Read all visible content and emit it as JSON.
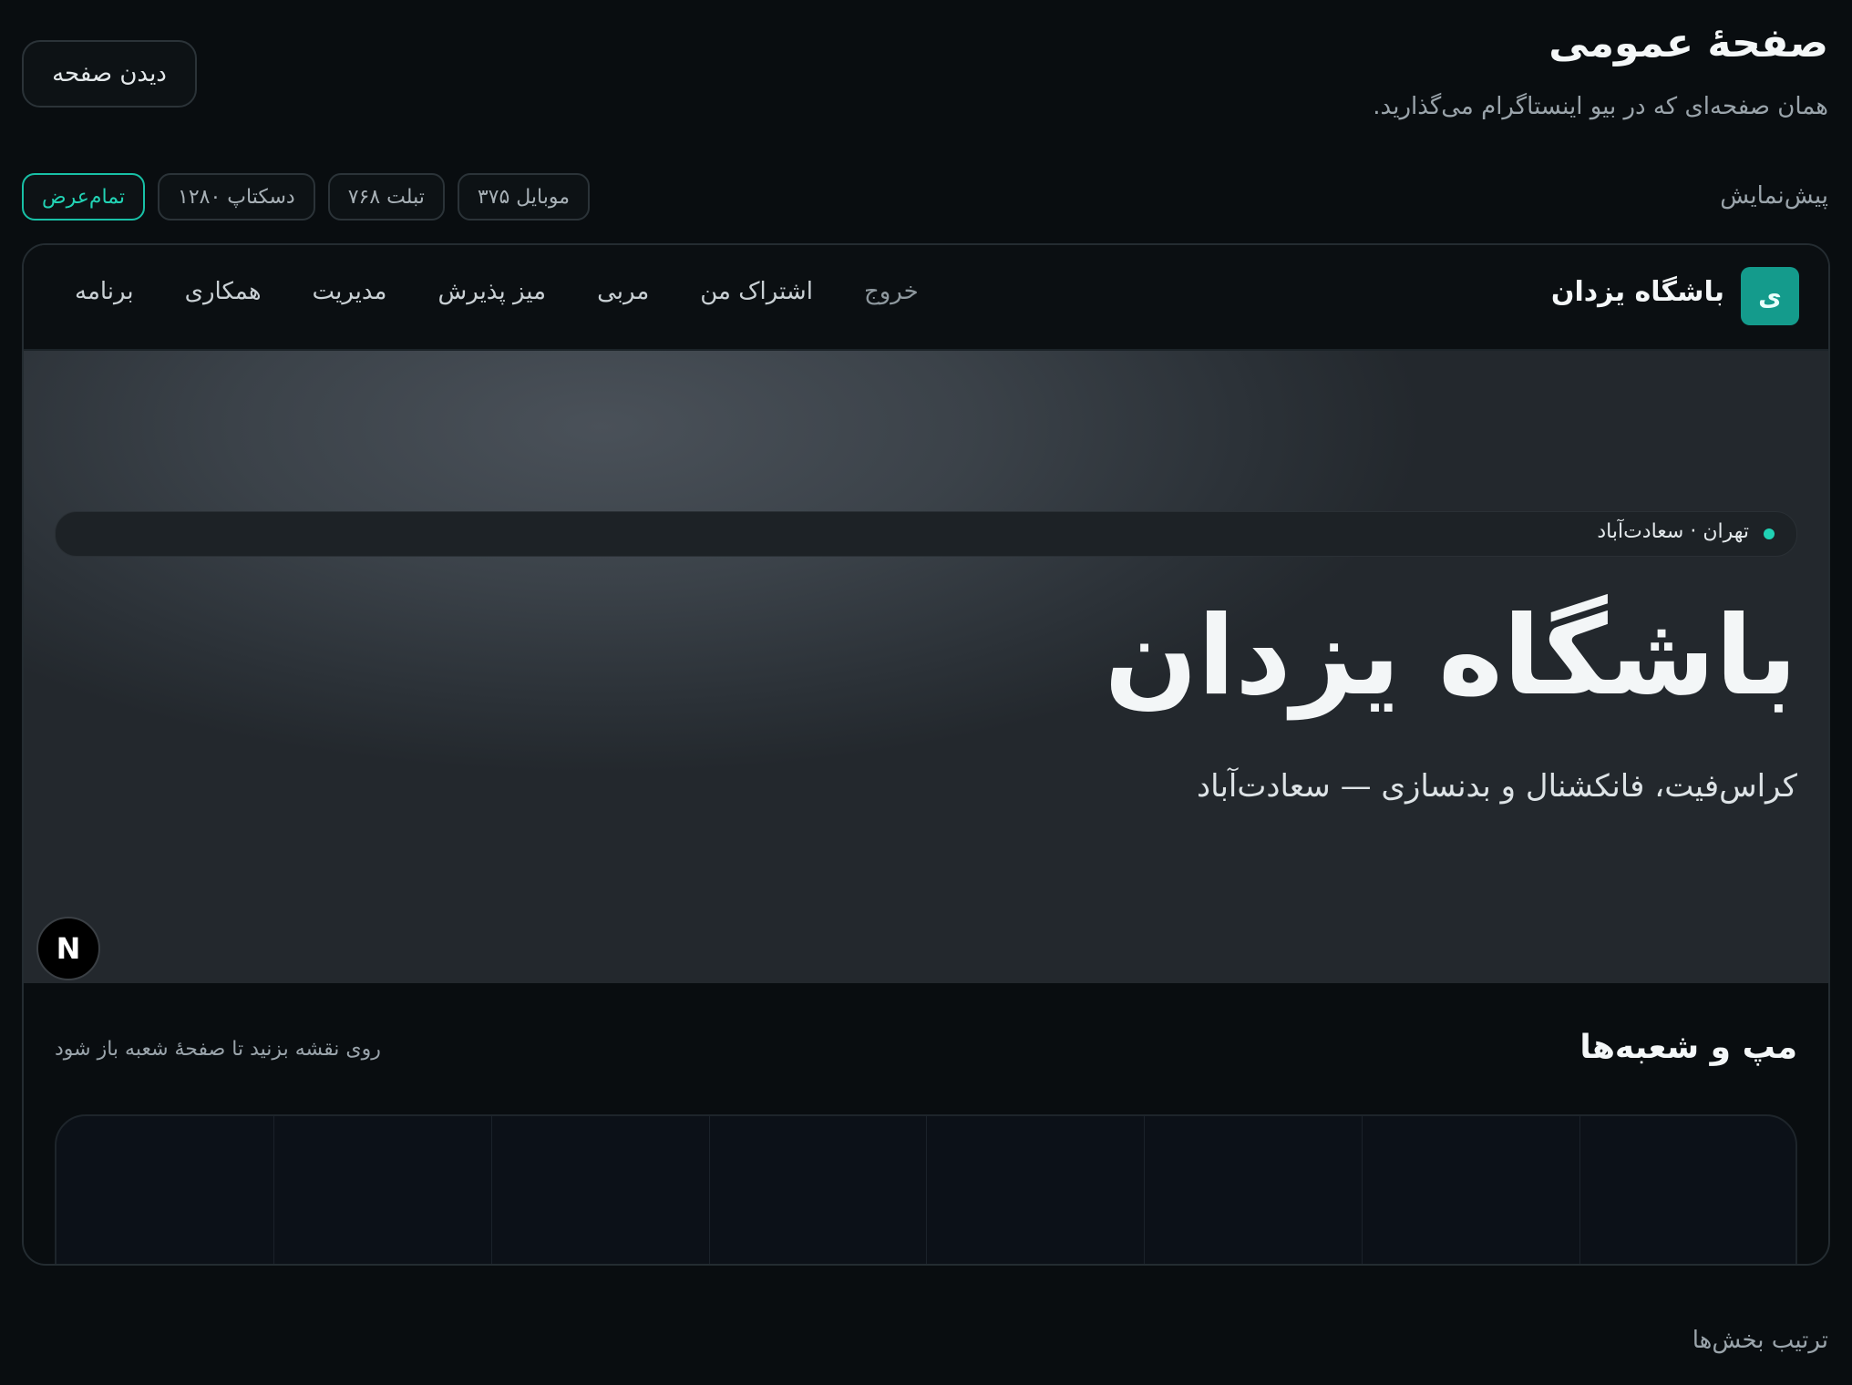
{
  "header": {
    "title": "صفحهٔ عمومی",
    "subtitle": "همان صفحه‌ای که در بیو اینستاگرام می‌گذارید.",
    "view_button": "دیدن صفحه"
  },
  "preview": {
    "label": "پیش‌نمایش",
    "devices": [
      "موبایل ۳۷۵",
      "تبلت ۷۶۸",
      "دسکتاپ ۱۲۸۰",
      "تمام‌عرض"
    ],
    "active_device": "تمام‌عرض"
  },
  "site": {
    "logo_letter": "ی",
    "brand": "باشگاه یزدان",
    "nav": [
      "برنامه",
      "همکاری",
      "مدیریت",
      "میز پذیرش",
      "مربی",
      "اشتراک من",
      "خروج"
    ],
    "hero": {
      "location": "تهران · سعادت‌آباد",
      "title": "باشگاه یزدان",
      "subtitle": "کراس‌فیت، فانکشنال و بدنسازی — سعادت‌آباد"
    },
    "map": {
      "title": "مپ و شعبه‌ها",
      "hint": "روی نقشه بزنید تا صفحهٔ شعبه باز شود"
    },
    "badge_letter": "N"
  },
  "sections": {
    "order_label": "ترتیب بخش‌ها"
  },
  "colors": {
    "accent": "#20d2b4",
    "logo_bg": "#149b8c",
    "background": "#090d10"
  }
}
